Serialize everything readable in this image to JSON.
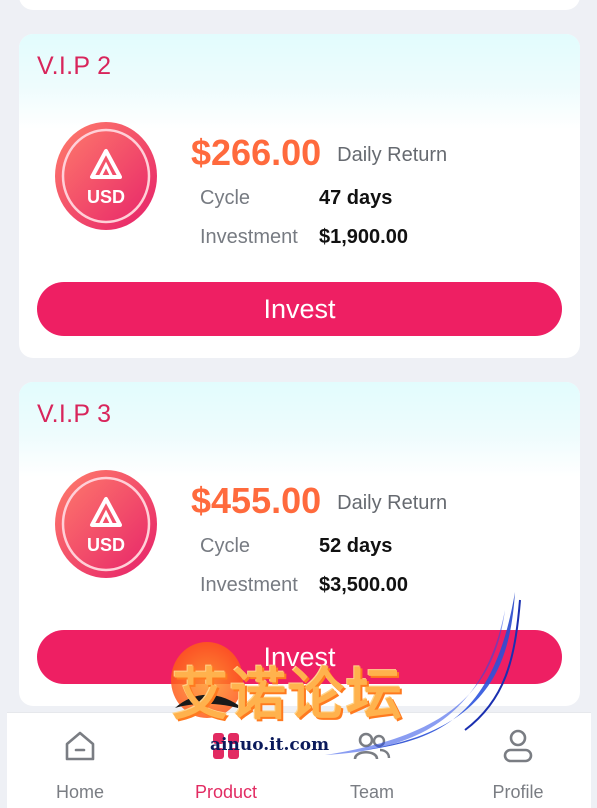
{
  "plans": [
    {
      "title": "V.I.P 2",
      "price": "$266.00",
      "price_label": "Daily Return",
      "cycle_label": "Cycle",
      "cycle_value": "47 days",
      "investment_label": "Investment",
      "investment_value": "$1,900.00",
      "button_label": "Invest",
      "coin_text": "USD"
    },
    {
      "title": "V.I.P 3",
      "price": "$455.00",
      "price_label": "Daily Return",
      "cycle_label": "Cycle",
      "cycle_value": "52 days",
      "investment_label": "Investment",
      "investment_value": "$3,500.00",
      "button_label": "Invest",
      "coin_text": "USD"
    }
  ],
  "nav": {
    "items": [
      {
        "label": "Home",
        "icon": "home-icon",
        "active": false
      },
      {
        "label": "Product",
        "icon": "product-icon",
        "active": true
      },
      {
        "label": "Team",
        "icon": "team-icon",
        "active": false
      },
      {
        "label": "Profile",
        "icon": "profile-icon",
        "active": false
      }
    ]
  },
  "watermark": {
    "text": "艾诺论坛",
    "url": "ainuo.it.com"
  },
  "colors": {
    "accent": "#ee1f63",
    "title": "#d8255b",
    "price": "#ff6a3d",
    "background": "#eef0f5"
  }
}
